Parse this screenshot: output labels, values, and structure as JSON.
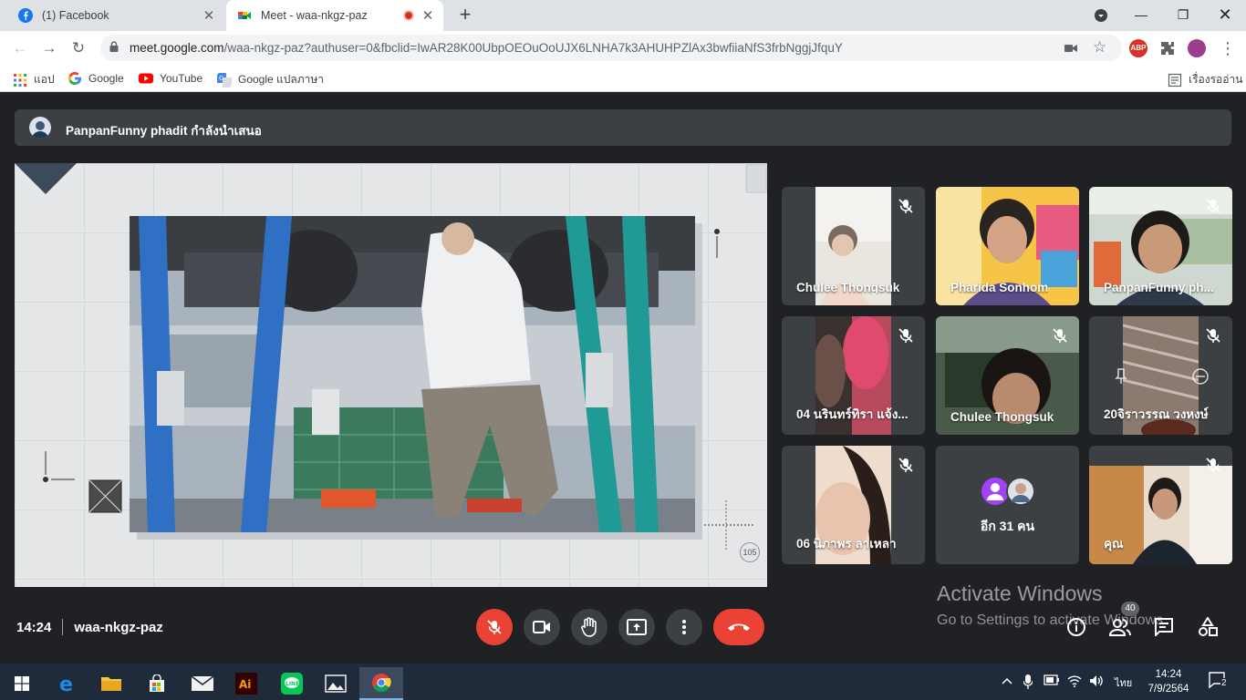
{
  "browser": {
    "tabs": [
      {
        "title": "(1) Facebook",
        "icon": "facebook-icon"
      },
      {
        "title": "Meet - waa-nkgz-paz",
        "icon": "google-meet-icon",
        "recording": true
      }
    ],
    "url": {
      "host": "meet.google.com",
      "path": "/waa-nkgz-paz?authuser=0&fbclid=IwAR28K00UbpOEOuOoUJX6LNHA7k3AHUHPZlAx3bwfiiaNfS3frbNggjJfquY"
    },
    "extensions": {
      "abp": "ABP"
    },
    "bookmarks": [
      {
        "label": "แอป",
        "icon": "apps-grid-icon"
      },
      {
        "label": "Google",
        "icon": "google-icon"
      },
      {
        "label": "YouTube",
        "icon": "youtube-icon"
      },
      {
        "label": "Google แปลภาษา",
        "icon": "translate-icon"
      }
    ],
    "reading_list": "เรื่องรออ่าน"
  },
  "meet": {
    "presenter_text": "PanpanFunny phadit กำลังนำเสนอ",
    "page_badge": "105",
    "participants": [
      {
        "name": "Chulee Thongsuk",
        "muted": true
      },
      {
        "name": "Pharida Sonhom",
        "muted": false
      },
      {
        "name": "PanpanFunny ph...",
        "muted": true
      },
      {
        "name": "04 นรินทร์ทิรา แจ้ง...",
        "muted": true
      },
      {
        "name": "Chulee Thongsuk",
        "muted": true
      },
      {
        "name": "20จิราวรรณ วงหงษ์",
        "muted": true
      },
      {
        "name": "06 นิภาพร ลาเหลา",
        "muted": true
      },
      {
        "name": "อีก 31 คน",
        "muted": false
      },
      {
        "name": "คุณ",
        "muted": true
      }
    ],
    "clock": "14:24",
    "meeting_code": "waa-nkgz-paz",
    "people_count": "40",
    "watermark_title": "Activate Windows",
    "watermark_sub": "Go to Settings to activate Windows."
  },
  "taskbar": {
    "time": "14:24",
    "date": "7/9/2564",
    "lang": "ไทย",
    "notifications": "2"
  },
  "colors": {
    "meet_bg": "#202124",
    "tile_bg": "#3c4043",
    "end_call": "#ea4335",
    "taskbar": "#1f2b3a"
  }
}
